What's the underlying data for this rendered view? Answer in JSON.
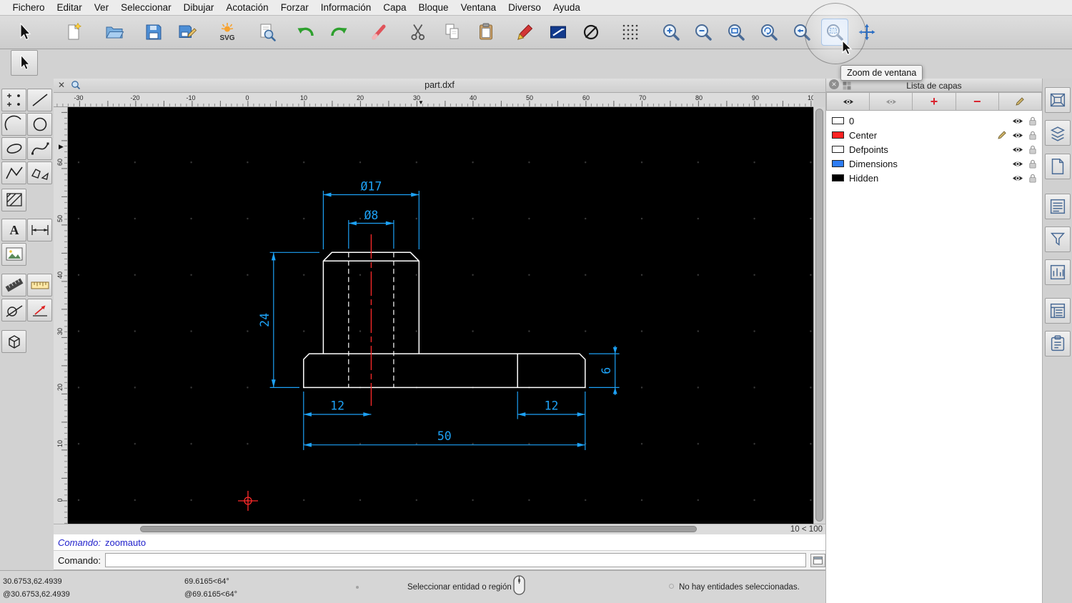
{
  "menubar": {
    "items": [
      "Fichero",
      "Editar",
      "Ver",
      "Seleccionar",
      "Dibujar",
      "Acotación",
      "Forzar",
      "Información",
      "Capa",
      "Bloque",
      "Ventana",
      "Diverso",
      "Ayuda"
    ]
  },
  "toolbar": {
    "tooltip": "Zoom de ventana"
  },
  "icons": {
    "svg_logo": "SVG",
    "text_tool": "A",
    "close": "✕",
    "panel_close": "✕",
    "plus": "+",
    "minus": "−",
    "ruler_marker": "▼",
    "palette_expander": "▶"
  },
  "mdi": {
    "title": "part.dxf"
  },
  "rulers": {
    "h": [
      "-30",
      "-20",
      "-10",
      "0",
      "10",
      "20",
      "30",
      "40",
      "50",
      "60",
      "70",
      "80",
      "90",
      "10"
    ],
    "v": [
      "60",
      "50",
      "40",
      "30",
      "20",
      "10",
      "0"
    ]
  },
  "drawing": {
    "dim_dia17": "Ø17",
    "dim_dia8": "Ø8",
    "dim_height24": "24",
    "dim_height6": "6",
    "dim_width12_left": "12",
    "dim_width12_right": "12",
    "dim_width50": "50"
  },
  "colors": {
    "dimension": "#1da1f5",
    "entity": "#ffffff",
    "centerline": "#ff2a2a"
  },
  "scroll": {
    "zoom_ratio": "10 < 100"
  },
  "command": {
    "history_label": "Comando:",
    "history_value": "zoomauto",
    "prompt_label": "Comando:",
    "input_value": ""
  },
  "statusbar": {
    "abs_coord": "30.6753,62.4939",
    "rel_coord": "@30.6753,62.4939",
    "abs_polar": "69.6165<64°",
    "rel_polar": "@69.6165<64°",
    "hint": "Seleccionar entidad o región",
    "selection": "No hay entidades seleccionadas."
  },
  "layers_panel": {
    "title": "Lista de capas",
    "layers": [
      {
        "name": "0",
        "color": "#ffffff",
        "current": false
      },
      {
        "name": "Center",
        "color": "#ff2222",
        "current": true
      },
      {
        "name": "Defpoints",
        "color": "#ffffff",
        "current": false
      },
      {
        "name": "Dimensions",
        "color": "#2e7df6",
        "current": false
      },
      {
        "name": "Hidden",
        "color": "#000000",
        "current": false
      }
    ]
  }
}
